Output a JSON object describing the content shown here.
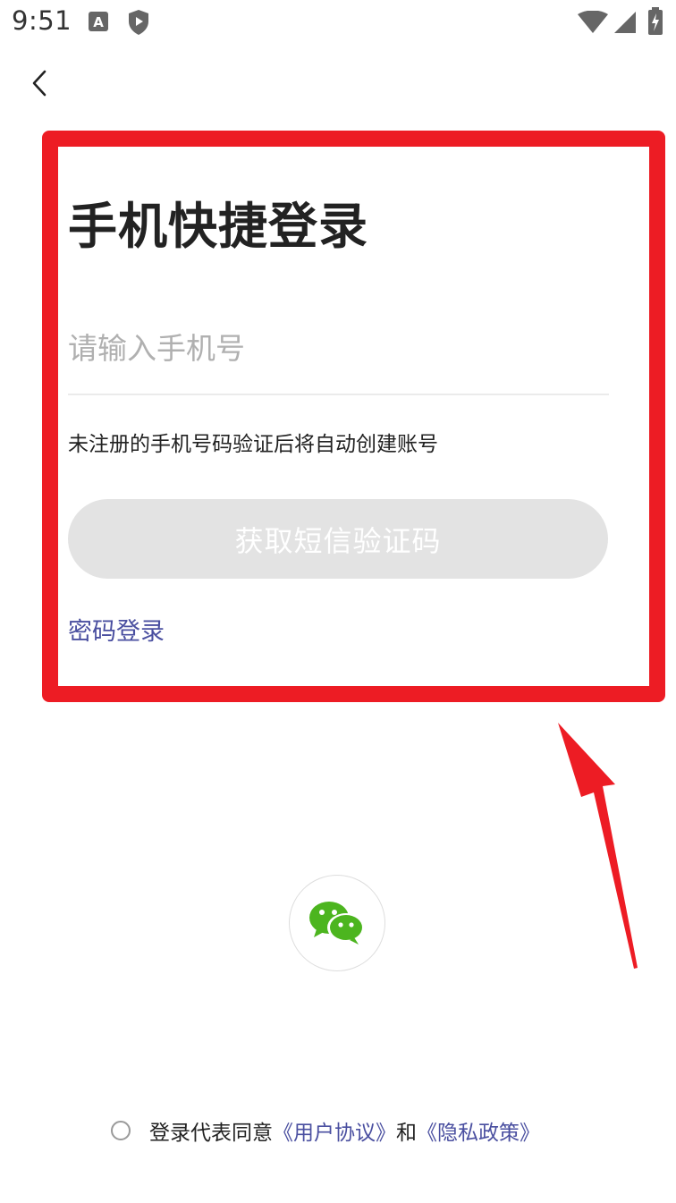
{
  "status_bar": {
    "time": "9:51",
    "icons": [
      "a-notification-icon",
      "shield-play-icon",
      "wifi-icon",
      "cell-signal-icon",
      "battery-charging-icon"
    ]
  },
  "nav": {
    "back_icon": "chevron-left-icon"
  },
  "login": {
    "title": "手机快捷登录",
    "phone_placeholder": "请输入手机号",
    "phone_value": "",
    "hint": "未注册的手机号码验证后将自动创建账号",
    "sms_button_label": "获取短信验证码",
    "password_login_label": "密码登录"
  },
  "social": {
    "wechat_icon": "wechat-icon"
  },
  "agreement": {
    "prefix": "登录代表同意",
    "user_agreement": "《用户协议》",
    "and": "和",
    "privacy_policy": "《隐私政策》"
  },
  "colors": {
    "accent_link": "#4a4fa0",
    "button_disabled": "#e3e3e3",
    "annotation_red": "#ed1c24",
    "wechat_green": "#4cb51f"
  }
}
